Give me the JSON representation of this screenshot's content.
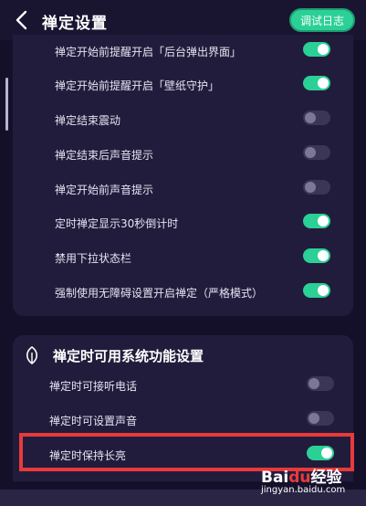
{
  "header": {
    "title": "禅定设置",
    "log_button": "调试日志"
  },
  "settings": [
    {
      "label": "禅定开始前提醒开启「后台弹出界面」",
      "on": true
    },
    {
      "label": "禅定开始前提醒开启「壁纸守护」",
      "on": true
    },
    {
      "label": "禅定结束震动",
      "on": false
    },
    {
      "label": "禅定结束后声音提示",
      "on": false
    },
    {
      "label": "禅定开始前声音提示",
      "on": false
    },
    {
      "label": "定时禅定显示30秒倒计时",
      "on": true
    },
    {
      "label": "禁用下拉状态栏",
      "on": true
    },
    {
      "label": "强制使用无障碍设置开启禅定（严格模式）",
      "on": true
    }
  ],
  "system_section": {
    "title": "禅定时可用系统功能设置",
    "items": [
      {
        "label": "禅定时可接听电话",
        "on": false
      },
      {
        "label": "禅定时可设置声音",
        "on": false
      },
      {
        "label": "禅定时保持长亮",
        "on": true
      }
    ]
  },
  "watermark": {
    "logo_left": "Bai",
    "logo_paw": "du",
    "logo_right": "经验",
    "url": "jingyan.baidu.com"
  },
  "colors": {
    "accent": "#2bd096",
    "background": "#15102a",
    "card": "#221c3c",
    "highlight": "#e83a3a"
  }
}
